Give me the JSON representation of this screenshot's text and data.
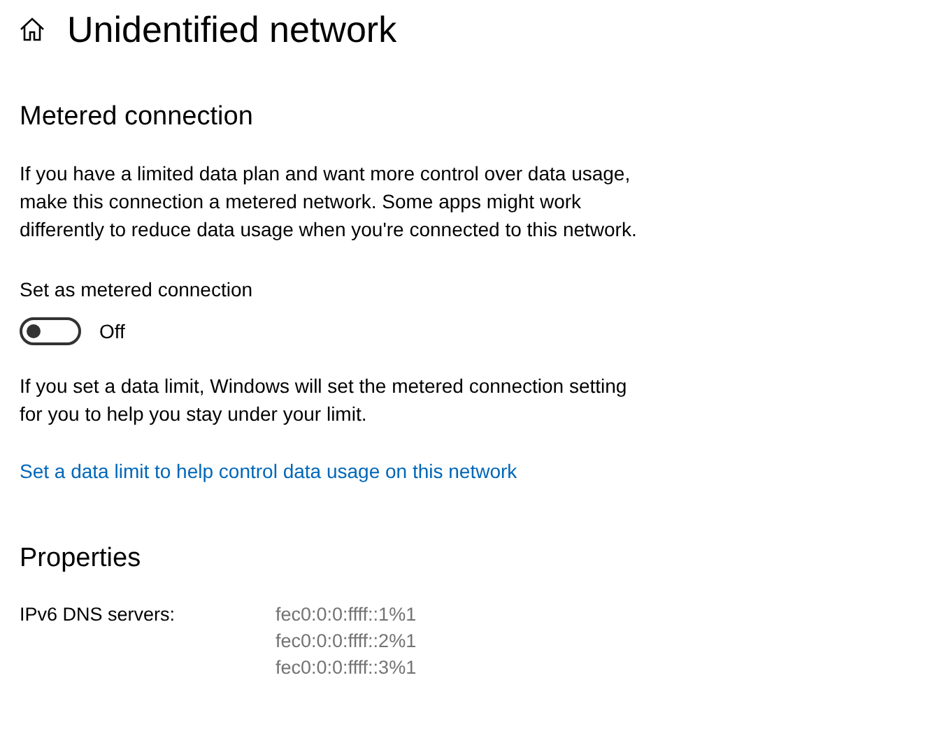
{
  "header": {
    "title": "Unidentified network"
  },
  "metered": {
    "heading": "Metered connection",
    "description": "If you have a limited data plan and want more control over data usage, make this connection a metered network. Some apps might work differently to reduce data usage when you're connected to this network.",
    "toggle": {
      "label": "Set as metered connection",
      "on": false,
      "state_text": "Off"
    },
    "note": "If you set a data limit, Windows will set the metered connection setting for you to help you stay under your limit.",
    "link": "Set a data limit to help control data usage on this network"
  },
  "properties": {
    "heading": "Properties",
    "rows": [
      {
        "label": "IPv6 DNS servers:",
        "values": [
          "fec0:0:0:ffff::1%1",
          "fec0:0:0:ffff::2%1",
          "fec0:0:0:ffff::3%1"
        ]
      }
    ]
  }
}
